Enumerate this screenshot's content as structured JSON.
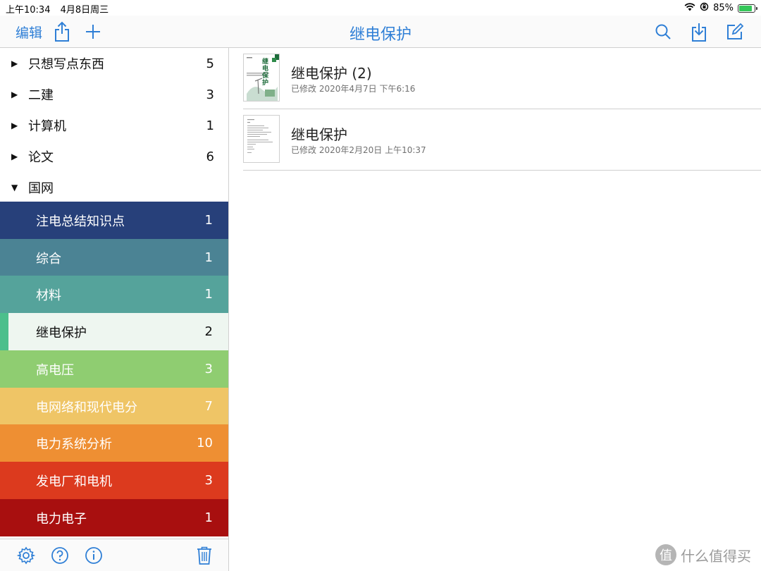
{
  "status_bar": {
    "time": "上午10:34",
    "date": "4月8日周三",
    "battery_percent": "85%",
    "battery_level": 0.85
  },
  "navbar": {
    "edit_label": "编辑",
    "title": "继电保护",
    "icons": [
      "share-icon",
      "add-icon",
      "search-icon",
      "download-icon",
      "compose-icon"
    ]
  },
  "sidebar": {
    "folders": [
      {
        "label": "只想写点东西",
        "count": "5",
        "expanded": false
      },
      {
        "label": "二建",
        "count": "3",
        "expanded": false
      },
      {
        "label": "计算机",
        "count": "1",
        "expanded": false
      },
      {
        "label": "论文",
        "count": "6",
        "expanded": false
      },
      {
        "label": "国网",
        "count": "",
        "expanded": true
      }
    ],
    "subfolders": [
      {
        "label": "注电总结知识点",
        "count": "1",
        "color": "#27407a"
      },
      {
        "label": "综合",
        "count": "1",
        "color": "#4b8394"
      },
      {
        "label": "材料",
        "count": "1",
        "color": "#55a39b"
      },
      {
        "label": "继电保护",
        "count": "2",
        "color": "#eef6f0",
        "selected": true,
        "accent": "#4cbf8c"
      },
      {
        "label": "高电压",
        "count": "3",
        "color": "#8fcd71"
      },
      {
        "label": "电网络和现代电分",
        "count": "7",
        "color": "#efc566"
      },
      {
        "label": "电力系统分析",
        "count": "10",
        "color": "#ee8f33"
      },
      {
        "label": "发电厂和电机",
        "count": "3",
        "color": "#dc3a1e"
      },
      {
        "label": "电力电子",
        "count": "1",
        "color": "#a80f0f"
      }
    ],
    "footer_icons": [
      "settings-icon",
      "help-icon",
      "info-icon",
      "trash-icon"
    ]
  },
  "documents": [
    {
      "title": "继电保护 (2)",
      "meta": "已修改 2020年4月7日 下午6:16",
      "thumb_text": "继电保护"
    },
    {
      "title": "继电保护",
      "meta": "已修改 2020年2月20日 上午10:37",
      "thumb_text": ""
    }
  ],
  "watermark": {
    "text": "什么值得买",
    "logo_char": "值"
  }
}
